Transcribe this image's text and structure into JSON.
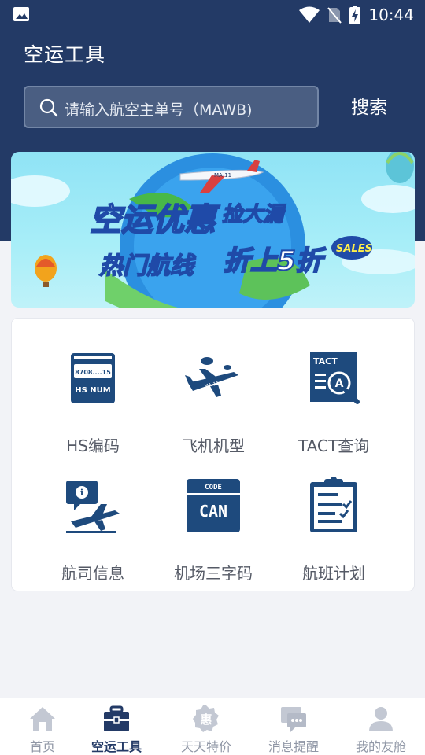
{
  "status_bar": {
    "time": "10:44"
  },
  "header": {
    "title": "空运工具",
    "search": {
      "placeholder": "请输入航空主单号（MAWB)",
      "button": "搜索"
    }
  },
  "banner": {
    "line1": "空运优惠",
    "line1_tail": "捡大漏",
    "line2": "热门航线",
    "line2_tail": "折上5折",
    "sales_badge": "SALES",
    "plane_label": "MA-11"
  },
  "tools": [
    {
      "label": "HS编码",
      "icon": "hs-code-icon",
      "icon_text_top": "8708....15",
      "icon_text_bottom": "HS NUM"
    },
    {
      "label": "飞机机型",
      "icon": "airplane-icon",
      "icon_text": "MA-11"
    },
    {
      "label": "TACT查询",
      "icon": "tact-search-icon",
      "icon_text": "TACT",
      "icon_letter": "A"
    },
    {
      "label": "航司信息",
      "icon": "airline-info-icon",
      "icon_letter": "i"
    },
    {
      "label": "机场三字码",
      "icon": "airport-code-icon",
      "icon_text_top": "CODE",
      "icon_text_bottom": "CAN"
    },
    {
      "label": "航班计划",
      "icon": "flight-plan-icon"
    }
  ],
  "tabs": [
    {
      "label": "首页",
      "icon": "home-icon",
      "active": false
    },
    {
      "label": "空运工具",
      "icon": "toolbox-icon",
      "active": true
    },
    {
      "label": "天天特价",
      "icon": "discount-badge-icon",
      "icon_char": "惠",
      "active": false
    },
    {
      "label": "消息提醒",
      "icon": "message-icon",
      "active": false
    },
    {
      "label": "我的友舱",
      "icon": "user-icon",
      "active": false
    }
  ],
  "colors": {
    "primary": "#233a66",
    "icon_blue": "#1e4a7d",
    "tab_inactive": "#9097a6"
  }
}
